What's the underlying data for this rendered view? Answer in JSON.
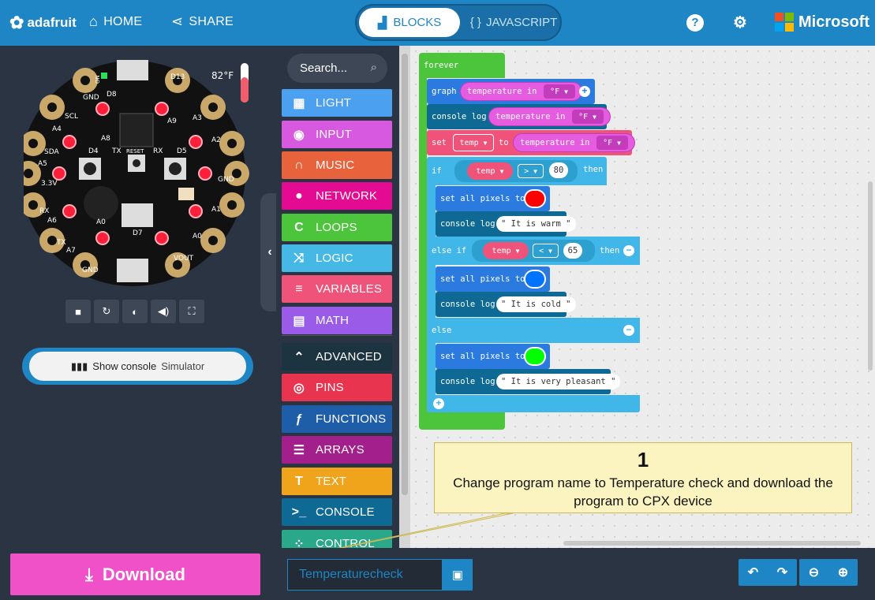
{
  "header": {
    "brand": "adafruit",
    "home_label": "HOME",
    "share_label": "SHARE",
    "mode_blocks": "BLOCKS",
    "mode_javascript": "JAVASCRIPT",
    "microsoft_label": "Microsoft",
    "icons": [
      "home-icon",
      "share-icon",
      "help-icon",
      "gear-icon"
    ]
  },
  "simulator": {
    "temperature_readout": "82°F",
    "pins": {
      "gnd_top": "GND",
      "d13": "D13",
      "d8": "D8",
      "scl": "SCL",
      "a4": "A4",
      "sda": "SDA",
      "a5": "A5",
      "v33": "3.3V",
      "rx": "RX",
      "a6": "A6",
      "tx": "TX",
      "a7": "A7",
      "gnd_left": "GND",
      "gnd_right": "GND",
      "a1": "A1",
      "a2": "A2",
      "a3": "A3",
      "a0": "A0",
      "vout": "VOUT",
      "a9": "A9",
      "a8": "A8",
      "d4": "D4",
      "d5": "D5",
      "reset": "RESET",
      "d7": "D7",
      "a0_mid": "A0",
      "tx_mid": "TX",
      "rx_mid": "RX",
      "on": "ON"
    },
    "control_icons": [
      "stop-icon",
      "restart-icon",
      "slowmo-icon",
      "sound-icon",
      "fullscreen-icon"
    ],
    "console_button_label": "Show console",
    "console_button_sub": "Simulator"
  },
  "toolbox": {
    "search_placeholder": "Search...",
    "categories": [
      {
        "label": "LIGHT",
        "color": "#4ca0f0"
      },
      {
        "label": "INPUT",
        "color": "#d659e0"
      },
      {
        "label": "MUSIC",
        "color": "#e8633b"
      },
      {
        "label": "NETWORK",
        "color": "#e40a91"
      },
      {
        "label": "LOOPS",
        "color": "#4cc43b"
      },
      {
        "label": "LOGIC",
        "color": "#45b8e6"
      },
      {
        "label": "VARIABLES",
        "color": "#f0537a"
      },
      {
        "label": "MATH",
        "color": "#9a5ce8"
      },
      {
        "label": "ADVANCED",
        "color": "#1c3340"
      },
      {
        "label": "PINS",
        "color": "#e8344f"
      },
      {
        "label": "FUNCTIONS",
        "color": "#1e5ea8"
      },
      {
        "label": "ARRAYS",
        "color": "#a3208c"
      },
      {
        "label": "TEXT",
        "color": "#f0a41c"
      },
      {
        "label": "CONSOLE",
        "color": "#0e6a95"
      },
      {
        "label": "CONTROL",
        "color": "#2aa88a"
      }
    ]
  },
  "code": {
    "forever": "forever",
    "graph": "graph",
    "temperature_in": "temperature in",
    "unit": "°F",
    "console_log": "console log",
    "set": "set",
    "to": "to",
    "var_temp": "temp",
    "if": "if",
    "then": "then",
    "else_if": "else if",
    "else": "else",
    "op_gt": ">",
    "op_lt": "<",
    "val_80": "80",
    "val_65": "65",
    "set_all_pixels_to": "set all pixels to",
    "str_warm": "\" It is warm \"",
    "str_cold": "\" It is cold \"",
    "str_pleasant": "\" It is very pleasant \"",
    "colors": {
      "red": "#ff0000",
      "blue": "#0073ff",
      "green": "#00ff00"
    }
  },
  "callout": {
    "number": "1",
    "text": "Change program name to Temperature check and download the program to CPX device"
  },
  "bottom": {
    "download_label": "Download",
    "project_name": "Temperaturecheck",
    "icons": [
      "download-icon",
      "save-icon",
      "undo-icon",
      "redo-icon",
      "zoom-out-icon",
      "zoom-in-icon"
    ]
  }
}
